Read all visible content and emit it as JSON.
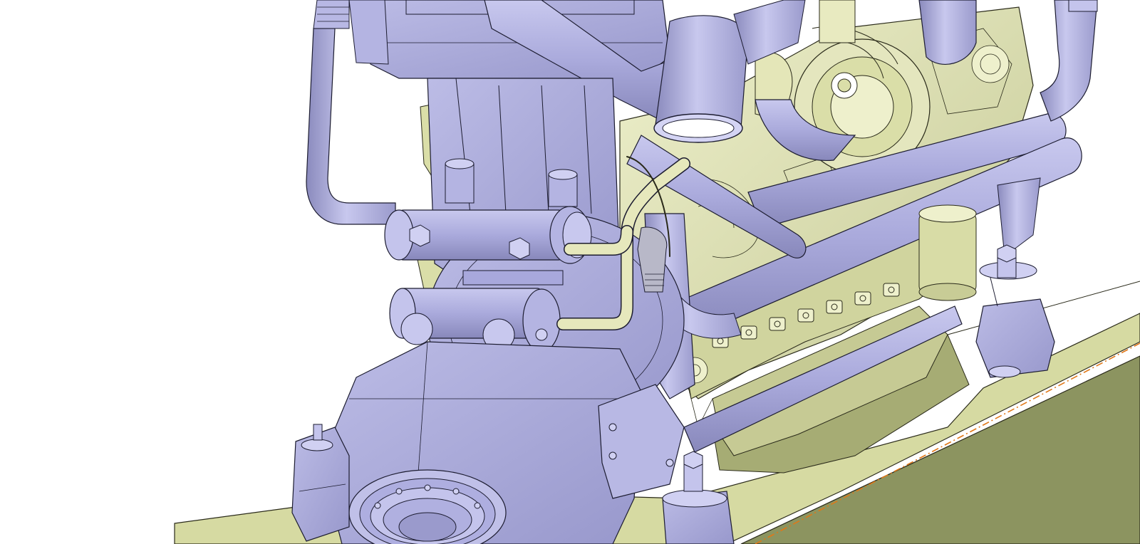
{
  "viewport": {
    "background": "#ffffff",
    "content": "cad-3d-assembly-view"
  },
  "colors": {
    "engine_metal": "#a8a8dc",
    "engine_metal_light": "#c4c4ec",
    "engine_metal_dark": "#8484b8",
    "outline": "#1c1c30",
    "engine_block_yellow": "#d8dca8",
    "engine_block_yellow_light": "#eceec8",
    "baseplate_top": "#d4d8a0",
    "baseplate_side": "#8c9460",
    "centerline": "#e07818"
  }
}
